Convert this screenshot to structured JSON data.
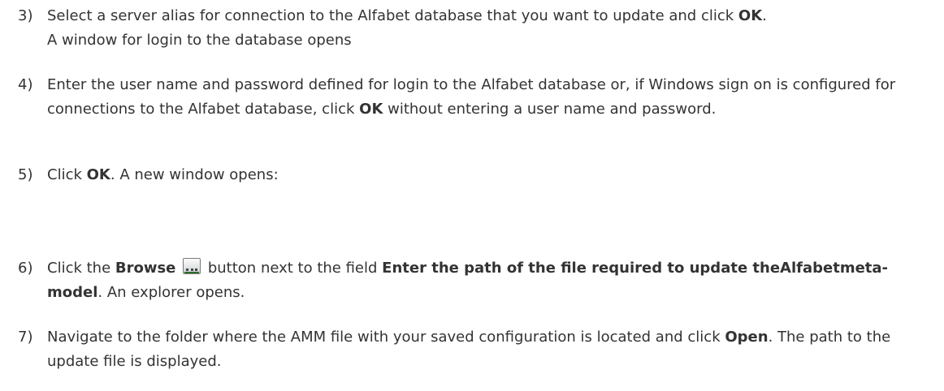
{
  "steps": [
    {
      "number": "3)",
      "line1_before": "Select a server alias for connection to the Alfabet database that you want to update and click ",
      "line1_bold": "OK",
      "line1_after": ".",
      "line2": "A window for login to the database opens"
    },
    {
      "number": "4)",
      "text_before": "Enter the user name and password defined for login to the Alfabet database or, if Windows sign on is configured for connections to the Alfabet database, click ",
      "bold": "OK",
      "text_after": " without entering a user name and password."
    },
    {
      "number": "5)",
      "text_before": "Click ",
      "bold": "OK",
      "text_after": ". A new window opens:"
    },
    {
      "number": "6)",
      "text_before": "Click the ",
      "bold1": "Browse",
      "icon": "browse-button-icon",
      "text_middle": " button next to the field ",
      "bold2": "Enter the path of the file required to update theAlfabetmeta-model",
      "text_after": ". An explorer opens."
    },
    {
      "number": "7)",
      "text_before": "Navigate to the folder where the AMM file with your saved configuration is located and click ",
      "bold": "Open",
      "text_after": ". The path to the update file is displayed."
    }
  ]
}
